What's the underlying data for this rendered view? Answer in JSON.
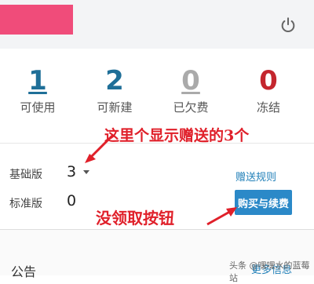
{
  "header": {
    "brand_color": "#f04c7a",
    "power_icon": "power-icon"
  },
  "stats": [
    {
      "value": "1",
      "label": "可使用",
      "color": "#1f6f98"
    },
    {
      "value": "2",
      "label": "可新建",
      "color": "#1f6f98"
    },
    {
      "value": "0",
      "label": "已欠费",
      "color": "#aaaaaa"
    },
    {
      "value": "0",
      "label": "冻结",
      "color": "#c4262e"
    }
  ],
  "annotations": {
    "gift_note": "这里个显示赠送的3个",
    "button_note": "没领取按钮"
  },
  "editions": [
    {
      "label": "基础版",
      "value": "3"
    },
    {
      "label": "标准版",
      "value": "0"
    }
  ],
  "links": {
    "gift_rules": "赠送规则",
    "more_info": "更多信息"
  },
  "buttons": {
    "buy_renew": "购买与续费"
  },
  "notice": {
    "title": "公告"
  },
  "watermark": "头条 @嘿嘿水的蓝莓站"
}
